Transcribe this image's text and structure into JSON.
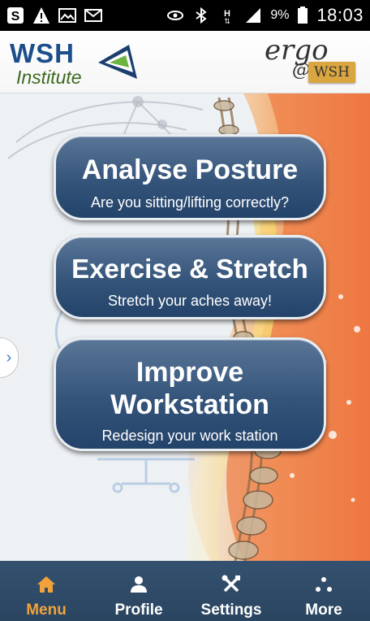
{
  "status_bar": {
    "battery": "9%",
    "time": "18:03",
    "icons": [
      "s-notification-icon",
      "warning-icon",
      "gallery-icon",
      "gmail-icon",
      "eye-icon",
      "bluetooth-icon",
      "data-icon",
      "signal-icon",
      "battery-icon"
    ]
  },
  "header": {
    "logo_wsh": "WSH",
    "logo_institute": "Institute",
    "ergo_text": "ergo",
    "ergo_at": "@",
    "ergo_wsh": "WSH"
  },
  "main": {
    "buttons": [
      {
        "title": "Analyse Posture",
        "subtitle": "Are you sitting/lifting correctly?"
      },
      {
        "title": "Exercise & Stretch",
        "subtitle": "Stretch your aches away!"
      },
      {
        "title_line1": "Improve",
        "title_line2": "Workstation",
        "subtitle": "Redesign your work station"
      }
    ],
    "side_tab_icon": "chevron-right-icon",
    "side_tab_glyph": "›"
  },
  "nav": {
    "items": [
      {
        "label": "Menu",
        "icon": "home-icon",
        "active": true
      },
      {
        "label": "Profile",
        "icon": "person-icon",
        "active": false
      },
      {
        "label": "Settings",
        "icon": "tools-icon",
        "active": false
      },
      {
        "label": "More",
        "icon": "more-dots-icon",
        "active": false
      }
    ]
  },
  "colors": {
    "nav_background": "#2f4a68",
    "active_tab": "#f2a23a",
    "button_blue": "#34547a",
    "wsh_blue": "#1b4e8a",
    "institute_green": "#3b6a1f",
    "ergo_tag": "#d9a640"
  }
}
